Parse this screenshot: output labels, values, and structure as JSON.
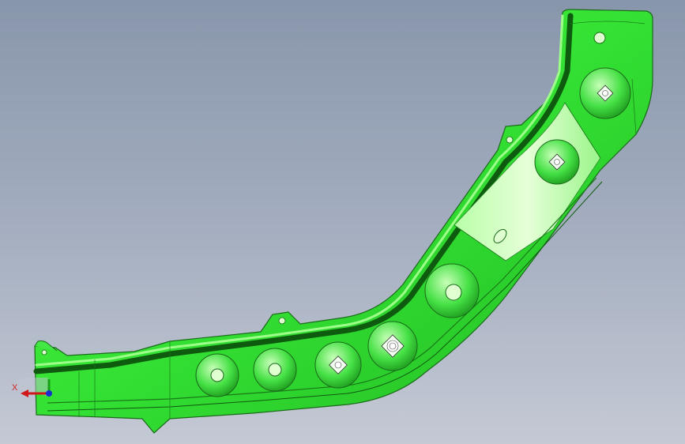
{
  "viewport": {
    "background_top": "#8896ab",
    "background_bottom": "#c4c9d4"
  },
  "part": {
    "color": "#3bf03b",
    "edge_color": "#1a6a1a",
    "highlight_color": "#d8ffcc"
  },
  "triad": {
    "x_label": "X",
    "x_color": "#d01818",
    "y_color": "#18a018",
    "z_color": "#1830d0"
  }
}
